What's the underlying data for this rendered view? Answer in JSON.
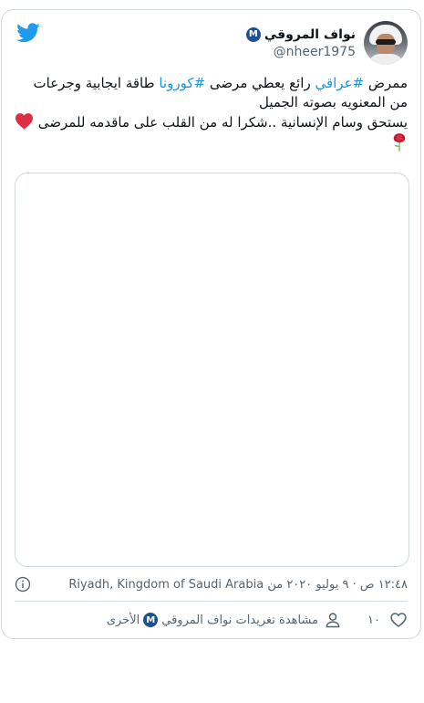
{
  "colors": {
    "link": "#1b95e0",
    "muted": "#536471",
    "twitter_blue": "#1d9bf0",
    "verified": "#1d4f91",
    "border": "#cfd9de"
  },
  "icons": [
    "twitter-bird-icon",
    "verified-m-icon",
    "heart-emoji-icon",
    "rose-emoji-icon",
    "info-icon",
    "heart-outline-icon",
    "person-icon"
  ],
  "author": {
    "display_name": "نواف المروقي",
    "verified_badge": "M",
    "handle": "@nheer1975"
  },
  "tweet": {
    "line1_prefix": "ممرض ",
    "hashtag1": "#عراقي",
    "line1_middle": "  رائع يعطي مرضى ",
    "hashtag2": "#كورونا",
    "line1_suffix": " طاقة ايجابية وجرعات من المعنويه بصوته الجميل",
    "line2": "يستحق وسام الإنسانية ..شكرا له من القلب على ماقدمه للمرضى"
  },
  "meta": {
    "timestamp": "١٢:٤٨ ص · ٩ يوليو ٢٠٢٠ من Riyadh, Kingdom of Saudi Arabia"
  },
  "actions": {
    "like_count": "١٠",
    "profile_prefix": "مشاهدة تغريدات نواف المروقي",
    "profile_suffix": "الأخرى",
    "profile_badge": "M"
  }
}
